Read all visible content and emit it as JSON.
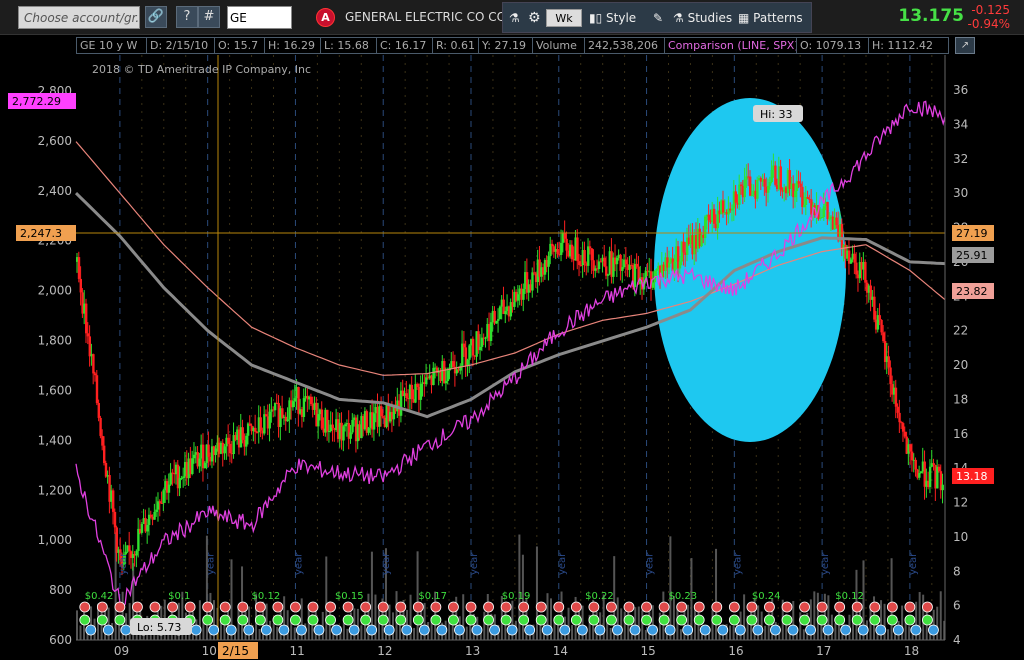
{
  "toolbar": {
    "account_placeholder": "Choose account/gr...",
    "help_label": "?",
    "hash_label": "#",
    "symbol": "GE",
    "alert_label": "A",
    "company_name": "GENERAL ELECTRIC CO COM",
    "timeframe": "Wk",
    "style_label": "Style",
    "studies_label": "Studies",
    "patterns_label": "Patterns",
    "last_price": "13.175",
    "net_change": "-0.125",
    "percent_change": "-0.94%"
  },
  "info_bar": {
    "period": "GE 10 y W",
    "date": "D: 2/15/10",
    "open": "O: 15.7",
    "high": "H: 16.29",
    "low": "L: 15.68",
    "close": "C: 16.17",
    "range": "R: 0.61",
    "y": "Y: 27.19",
    "volume_label": "Volume",
    "volume_value": "242,538,206",
    "comparison": "Comparison (LINE, SPX)",
    "cmp_open": "O: 1079.13",
    "cmp_high": "H: 1112.42"
  },
  "chart_labels": {
    "copyright": "2018 © TD Ameritrade IP Company, Inc",
    "spx_tag": "2,772.29",
    "crosshair_left": "2,247.3",
    "crosshair_right": "27.19",
    "sma_50": "25.91",
    "sma_200": "23.82",
    "last_tag": "13.18",
    "high_bubble": "Hi: 33",
    "low_bubble": "Lo: 5.73",
    "cursor_date": "2/15",
    "year_marker": "year"
  },
  "colors": {
    "up_candle": "#2fe02f",
    "down_candle": "#ff2020",
    "spx_line": "#e040e0",
    "sma_gray": "#8a8a8a",
    "sma_salmon": "#e8847a",
    "highlight_ellipse": "#1ec8f0",
    "crosshair": "#b8860b"
  },
  "chart_data": {
    "type": "line",
    "x": [
      "2008.5",
      "2009",
      "2009.5",
      "2010",
      "2010.5",
      "2011",
      "2011.5",
      "2012",
      "2012.5",
      "2013",
      "2013.5",
      "2014",
      "2014.5",
      "2015",
      "2015.5",
      "2016",
      "2016.5",
      "2017",
      "2017.5",
      "2018",
      "2018.4"
    ],
    "series": [
      {
        "values": [
          26,
          8,
          13,
          15,
          16,
          18,
          16,
          17,
          19,
          21,
          24,
          27,
          26,
          25,
          27,
          30,
          31,
          29,
          25,
          14,
          13.2
        ]
      },
      {
        "values": [
          1280,
          750,
          990,
          1110,
          1060,
          1300,
          1270,
          1250,
          1380,
          1480,
          1650,
          1840,
          1960,
          2040,
          2060,
          2000,
          2150,
          2350,
          2540,
          2750,
          2700
        ]
      },
      {
        "values": [
          30,
          27.5,
          24.5,
          22,
          20,
          19,
          18,
          17.8,
          17,
          18,
          19.6,
          20.6,
          21.4,
          22.2,
          23.2,
          25.5,
          26.6,
          27.4,
          27.3,
          26,
          25.9
        ]
      },
      {
        "values": [
          33,
          30,
          27,
          24.5,
          22.2,
          21,
          20,
          19.4,
          19.5,
          20,
          20.7,
          21.8,
          22.6,
          23,
          23.7,
          24.7,
          25.8,
          26.6,
          27,
          25.5,
          23.8
        ]
      }
    ],
    "y_right_ticks": [
      4,
      6,
      8,
      10,
      12,
      14,
      16,
      18,
      20,
      22,
      24,
      26,
      28,
      30,
      32,
      34,
      36
    ],
    "y_left_ticks": [
      "600",
      "800",
      "1,000",
      "1,200",
      "1,400",
      "1,600",
      "1,800",
      "2,000",
      "2,200",
      "2,400",
      "2,600",
      "2,800"
    ],
    "x_ticks": [
      "09",
      "10",
      "11",
      "12",
      "13",
      "14",
      "15",
      "16",
      "17",
      "18"
    ],
    "ylim_right": [
      4,
      36
    ],
    "ylim_left": [
      600,
      2800
    ],
    "dividends": [
      "$0.42",
      "$0.1",
      "$0.12",
      "$0.15",
      "$0.17",
      "$0.19",
      "$0.22",
      "$0.23",
      "$0.24",
      "$0.12"
    ]
  }
}
